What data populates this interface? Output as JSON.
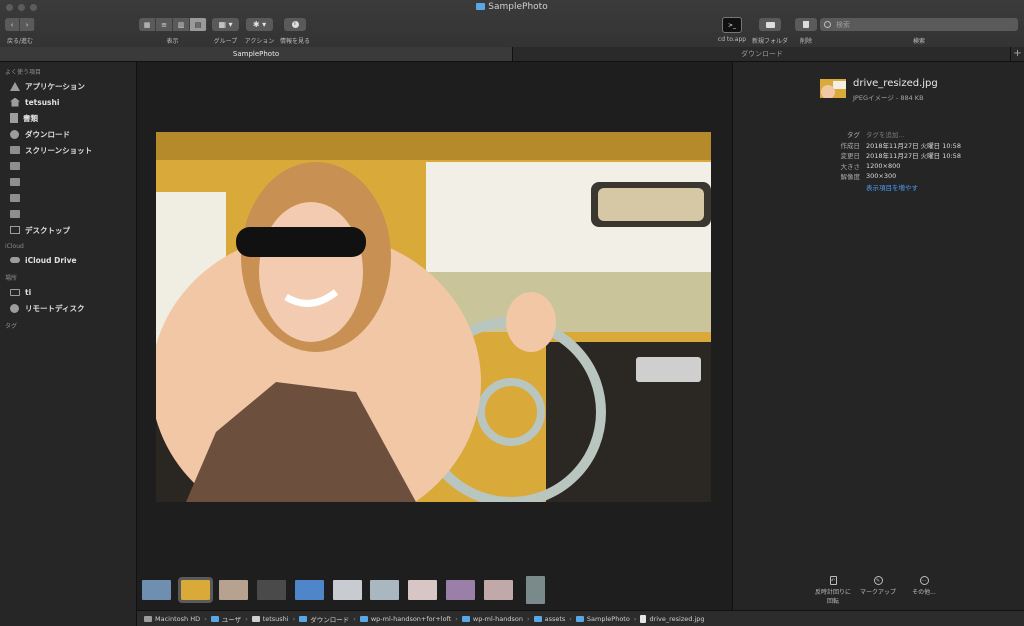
{
  "window": {
    "title": "SamplePhoto"
  },
  "toolbar": {
    "nav_label": "戻る/進む",
    "view_label": "表示",
    "group_label": "グループ",
    "action_label": "アクション",
    "info_label": "情報を見る",
    "cd_label": "cd to.app",
    "new_folder_label": "新規フォルダ",
    "delete_label": "削除",
    "search_label": "検索",
    "search_placeholder": "検索"
  },
  "tabs": [
    {
      "label": "SamplePhoto",
      "active": true
    },
    {
      "label": "ダウンロード",
      "active": false
    }
  ],
  "sidebar": {
    "favorites_header": "よく使う項目",
    "favorites": [
      {
        "label": "アプリケーション",
        "icon": "applications-icon"
      },
      {
        "label": "tetsushi",
        "icon": "home-icon"
      },
      {
        "label": "書類",
        "icon": "documents-icon"
      },
      {
        "label": "ダウンロード",
        "icon": "downloads-icon"
      },
      {
        "label": "スクリーンショット",
        "icon": "folder-icon"
      },
      {
        "label": "",
        "icon": "folder-icon"
      },
      {
        "label": "",
        "icon": "folder-icon"
      },
      {
        "label": "",
        "icon": "folder-icon"
      },
      {
        "label": "",
        "icon": "folder-icon"
      },
      {
        "label": "デスクトップ",
        "icon": "desktop-icon"
      }
    ],
    "icloud_header": "iCloud",
    "icloud": [
      {
        "label": "iCloud Drive",
        "icon": "cloud-icon"
      }
    ],
    "locations_header": "場所",
    "locations": [
      {
        "label": "ti",
        "icon": "disk-icon"
      },
      {
        "label": "リモートディスク",
        "icon": "remote-disc-icon"
      }
    ],
    "tags_header": "タグ"
  },
  "inspector": {
    "file_name": "drive_resized.jpg",
    "file_kind": "JPEGイメージ - 884 KB",
    "rows": [
      {
        "key": "タグ",
        "value": "タグを追加...",
        "placeholder": true
      },
      {
        "key": "作成日",
        "value": "2018年11月27日 火曜日 10:58"
      },
      {
        "key": "変更日",
        "value": "2018年11月27日 火曜日 10:58"
      },
      {
        "key": "大きさ",
        "value": "1200×800"
      },
      {
        "key": "解像度",
        "value": "300×300"
      }
    ],
    "show_more": "表示項目を増やす",
    "actions": {
      "rotate": "反時計回りに回転",
      "markup": "マークアップ",
      "more": "その他..."
    }
  },
  "thumbnails": {
    "count": 11,
    "selected_index": 1
  },
  "pathbar": [
    {
      "label": "Macintosh HD",
      "icon": "hd"
    },
    {
      "label": "ユーザ",
      "icon": "folder"
    },
    {
      "label": "tetsushi",
      "icon": "home"
    },
    {
      "label": "ダウンロード",
      "icon": "folder"
    },
    {
      "label": "wp-ml-handson+for+loft",
      "icon": "folder"
    },
    {
      "label": "wp-ml-handson",
      "icon": "folder"
    },
    {
      "label": "assets",
      "icon": "folder"
    },
    {
      "label": "SamplePhoto",
      "icon": "folder"
    },
    {
      "label": "drive_resized.jpg",
      "icon": "file"
    }
  ],
  "colors": {
    "accent": "#4a9ff5",
    "folder_blue": "#5aa7e6"
  }
}
